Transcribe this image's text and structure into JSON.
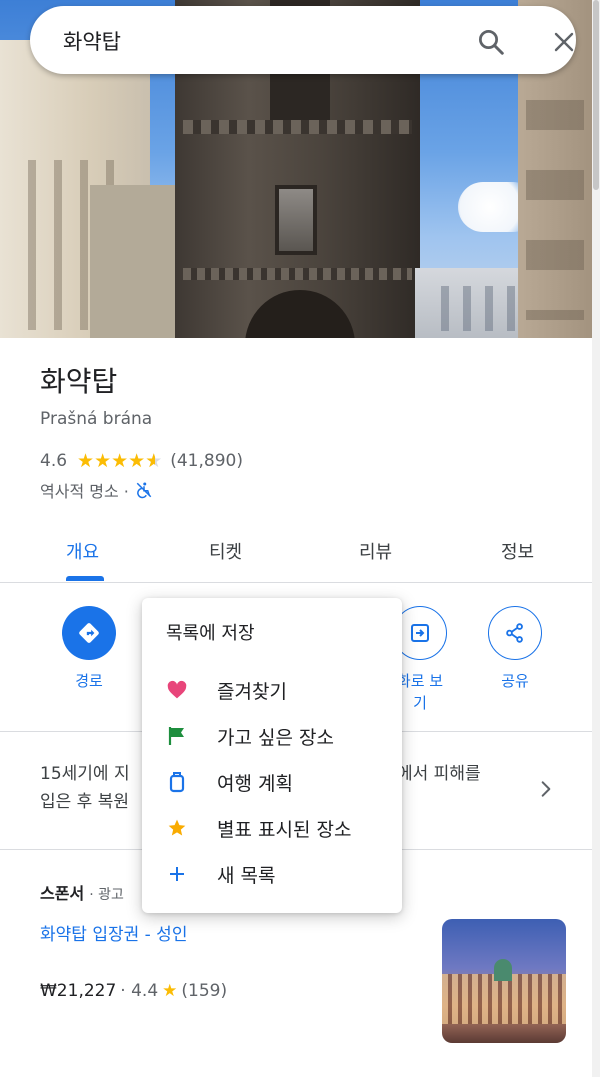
{
  "search": {
    "query": "화약탑"
  },
  "place": {
    "name": "화약탑",
    "local_name": "Prašná brána",
    "rating": "4.6",
    "rating_value": 4.6,
    "review_count": "(41,890)",
    "category": "역사적 명소 ·"
  },
  "tabs": [
    {
      "label": "개요",
      "active": true
    },
    {
      "label": "티켓",
      "active": false
    },
    {
      "label": "리뷰",
      "active": false
    },
    {
      "label": "정보",
      "active": false
    }
  ],
  "actions": {
    "directions": "경로",
    "view_label_line1": "화로 보",
    "view_label_line2": "기",
    "share": "공유"
  },
  "description": {
    "line1_left": "15세기에 지",
    "line1_right": "에서 피해를",
    "line2_left": "입은 후 복원"
  },
  "sponsor": {
    "label": "스폰서",
    "ad_text": "· 광고",
    "link": "화약탑 입장권 - 성인",
    "price": "₩21,227",
    "rating": "· 4.4",
    "review_count": "(159)"
  },
  "save_menu": {
    "title": "목록에 저장",
    "items": [
      {
        "label": "즐겨찾기",
        "icon": "heart-icon",
        "color": "#e8457a"
      },
      {
        "label": "가고 싶은 장소",
        "icon": "flag-icon",
        "color": "#1e8e3e"
      },
      {
        "label": "여행 계획",
        "icon": "suitcase-icon",
        "color": "#1a73e8"
      },
      {
        "label": "별표 표시된 장소",
        "icon": "star-icon",
        "color": "#f9ab00"
      },
      {
        "label": "새 목록",
        "icon": "plus-icon",
        "color": "#1a73e8"
      }
    ]
  },
  "colors": {
    "accent": "#1a73e8",
    "star": "#fbbc04",
    "text": "#202124",
    "muted": "#5f6368"
  }
}
